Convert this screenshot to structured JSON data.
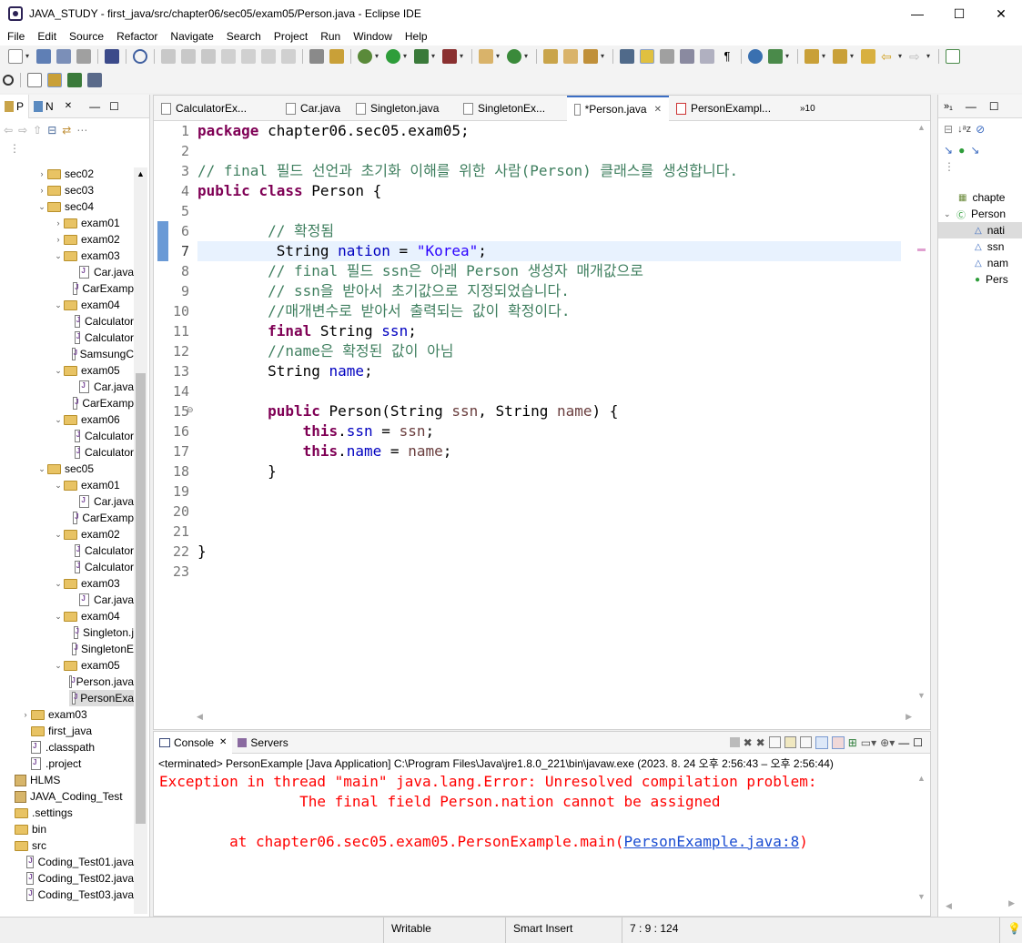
{
  "window": {
    "title": "JAVA_STUDY - first_java/src/chapter06/sec05/exam05/Person.java - Eclipse IDE",
    "minimize": "—",
    "maximize": "☐",
    "close": "✕"
  },
  "menu": [
    "File",
    "Edit",
    "Source",
    "Refactor",
    "Navigate",
    "Search",
    "Project",
    "Run",
    "Window",
    "Help"
  ],
  "left_panel": {
    "tabs": [
      {
        "label": "P"
      },
      {
        "label": "N"
      }
    ],
    "tree": [
      {
        "label": "sec02",
        "type": "folder",
        "indent": 1,
        "expanded": false
      },
      {
        "label": "sec03",
        "type": "folder",
        "indent": 1,
        "expanded": false
      },
      {
        "label": "sec04",
        "type": "folder",
        "indent": 1,
        "expanded": true
      },
      {
        "label": "exam01",
        "type": "folder",
        "indent": 2,
        "expanded": false
      },
      {
        "label": "exam02",
        "type": "folder",
        "indent": 2,
        "expanded": false
      },
      {
        "label": "exam03",
        "type": "folder",
        "indent": 2,
        "expanded": true
      },
      {
        "label": "Car.java",
        "type": "file",
        "indent": 3
      },
      {
        "label": "CarExamp",
        "type": "file",
        "indent": 3
      },
      {
        "label": "exam04",
        "type": "folder",
        "indent": 2,
        "expanded": true
      },
      {
        "label": "Calculator",
        "type": "file",
        "indent": 3
      },
      {
        "label": "Calculator",
        "type": "file",
        "indent": 3
      },
      {
        "label": "SamsungC",
        "type": "file",
        "indent": 3
      },
      {
        "label": "exam05",
        "type": "folder",
        "indent": 2,
        "expanded": true
      },
      {
        "label": "Car.java",
        "type": "file",
        "indent": 3
      },
      {
        "label": "CarExamp",
        "type": "file",
        "indent": 3
      },
      {
        "label": "exam06",
        "type": "folder",
        "indent": 2,
        "expanded": true
      },
      {
        "label": "Calculator",
        "type": "file",
        "indent": 3
      },
      {
        "label": "Calculator",
        "type": "file",
        "indent": 3
      },
      {
        "label": "sec05",
        "type": "folder",
        "indent": 1,
        "expanded": true
      },
      {
        "label": "exam01",
        "type": "folder",
        "indent": 2,
        "expanded": true
      },
      {
        "label": "Car.java",
        "type": "file",
        "indent": 3
      },
      {
        "label": "CarExamp",
        "type": "file",
        "indent": 3
      },
      {
        "label": "exam02",
        "type": "folder",
        "indent": 2,
        "expanded": true
      },
      {
        "label": "Calculator",
        "type": "file",
        "indent": 3
      },
      {
        "label": "Calculator",
        "type": "file",
        "indent": 3
      },
      {
        "label": "exam03",
        "type": "folder",
        "indent": 2,
        "expanded": true
      },
      {
        "label": "Car.java",
        "type": "file",
        "indent": 3
      },
      {
        "label": "exam04",
        "type": "folder",
        "indent": 2,
        "expanded": true
      },
      {
        "label": "Singleton.j",
        "type": "file",
        "indent": 3
      },
      {
        "label": "SingletonE",
        "type": "file",
        "indent": 3
      },
      {
        "label": "exam05",
        "type": "folder",
        "indent": 2,
        "expanded": true
      },
      {
        "label": "Person.java",
        "type": "file",
        "indent": 3
      },
      {
        "label": "PersonExa",
        "type": "file",
        "indent": 3,
        "selected": true
      },
      {
        "label": "exam03",
        "type": "folder",
        "indent": 0,
        "expanded": false
      },
      {
        "label": "first_java",
        "type": "folder",
        "indent": 0
      },
      {
        "label": ".classpath",
        "type": "xfile",
        "indent": 0
      },
      {
        "label": ".project",
        "type": "xfile",
        "indent": 0
      },
      {
        "label": "HLMS",
        "type": "project",
        "indent": -1
      },
      {
        "label": "JAVA_Coding_Test",
        "type": "project",
        "indent": -1
      },
      {
        "label": ".settings",
        "type": "folder",
        "indent": -1
      },
      {
        "label": "bin",
        "type": "folder",
        "indent": -1
      },
      {
        "label": "src",
        "type": "folder",
        "indent": -1
      },
      {
        "label": "Coding_Test01.java",
        "type": "file",
        "indent": 0
      },
      {
        "label": "Coding_Test02.java",
        "type": "file",
        "indent": 0
      },
      {
        "label": "Coding_Test03.java",
        "type": "file",
        "indent": 0
      }
    ]
  },
  "editor": {
    "tabs": [
      {
        "label": "CalculatorEx...",
        "active": false
      },
      {
        "label": "Car.java",
        "active": false
      },
      {
        "label": "Singleton.java",
        "active": false
      },
      {
        "label": "SingletonEx...",
        "active": false
      },
      {
        "label": "*Person.java",
        "active": true
      },
      {
        "label": "PersonExampl...",
        "active": false
      }
    ],
    "overflow_label": "»10",
    "line_numbers": [
      "1",
      "2",
      "3",
      "4",
      "5",
      "6",
      "7",
      "8",
      "9",
      "10",
      "11",
      "12",
      "13",
      "14",
      "15",
      "16",
      "17",
      "18",
      "19",
      "20",
      "21",
      "22",
      "23"
    ],
    "current_line": "7"
  },
  "outline": {
    "items": [
      {
        "label": "chapte",
        "icon": "package-icon"
      },
      {
        "label": "Person",
        "icon": "class-icon"
      },
      {
        "label": "nati",
        "icon": "field-icon",
        "selected": true
      },
      {
        "label": "ssn",
        "icon": "final-field-icon"
      },
      {
        "label": "nam",
        "icon": "field-icon"
      },
      {
        "label": "Pers",
        "icon": "constructor-icon"
      }
    ]
  },
  "console": {
    "tabs": [
      {
        "label": "Console"
      },
      {
        "label": "Servers"
      }
    ],
    "status": "<terminated> PersonExample [Java Application] C:\\Program Files\\Java\\jre1.8.0_221\\bin\\javaw.exe  (2023. 8. 24 오후 2:56:43 – 오후 2:56:44)",
    "line1": "Exception in thread \"main\" java.lang.Error: Unresolved compilation problem: ",
    "line2": "\tThe final field Person.nation cannot be assigned",
    "line3_prefix": "\tat chapter06.sec05.exam05.PersonExample.main(",
    "line3_link": "PersonExample.java:8",
    "line3_suffix": ")"
  },
  "statusbar": {
    "writable": "Writable",
    "insert_mode": "Smart Insert",
    "position": "7 : 9 : 124"
  }
}
